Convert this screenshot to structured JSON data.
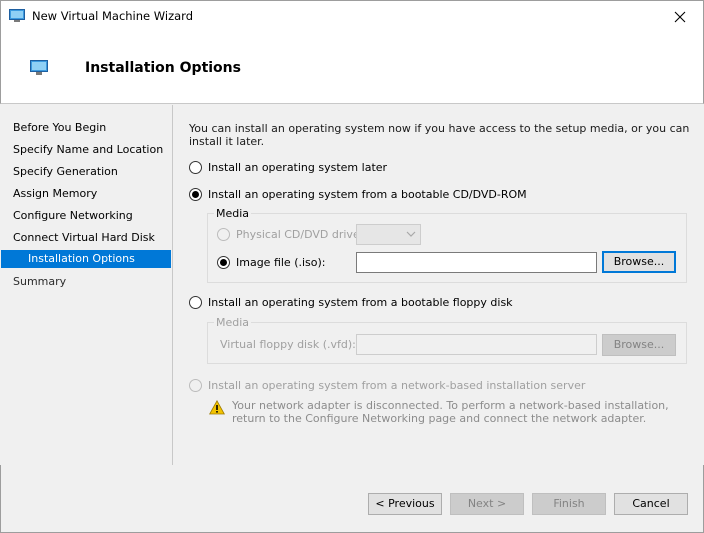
{
  "window": {
    "title": "New Virtual Machine Wizard"
  },
  "header": {
    "title": "Installation Options"
  },
  "nav": {
    "items": [
      {
        "label": "Before You Begin"
      },
      {
        "label": "Specify Name and Location"
      },
      {
        "label": "Specify Generation"
      },
      {
        "label": "Assign Memory"
      },
      {
        "label": "Configure Networking"
      },
      {
        "label": "Connect Virtual Hard Disk"
      },
      {
        "label": "Installation Options"
      },
      {
        "label": "Summary"
      }
    ]
  },
  "content": {
    "intro": "You can install an operating system now if you have access to the setup media, or you can install it later.",
    "option_later": "Install an operating system later",
    "option_cd": "Install an operating system from a bootable CD/DVD-ROM",
    "media_group_label": "Media",
    "physical_drive_label": "Physical CD/DVD drive:",
    "image_file_label": "Image file (.iso):",
    "image_file_value": "",
    "browse_iso": "Browse...",
    "option_floppy": "Install an operating system from a bootable floppy disk",
    "floppy_media_label": "Media",
    "floppy_disk_label": "Virtual floppy disk (.vfd):",
    "floppy_value": "",
    "browse_floppy": "Browse...",
    "option_network": "Install an operating system from a network-based installation server",
    "network_warning": "Your network adapter is disconnected. To perform a network-based installation, return to the Configure Networking page and connect the network adapter."
  },
  "footer": {
    "previous": "< Previous",
    "next": "Next >",
    "finish": "Finish",
    "cancel": "Cancel"
  },
  "colors": {
    "accent": "#0078d7",
    "disabled_text": "#a0a0a0",
    "warning": "#f2c200"
  }
}
